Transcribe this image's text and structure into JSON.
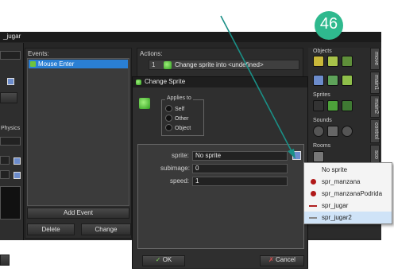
{
  "window": {
    "title": "_jugar"
  },
  "events": {
    "header": "Events:",
    "items": [
      "Mouse Enter"
    ],
    "add_button": "Add Event",
    "delete_button": "Delete",
    "change_button": "Change"
  },
  "actions": {
    "header": "Actions:",
    "items": [
      {
        "index": "1",
        "text": "Change sprite into <undefined>"
      }
    ]
  },
  "left_panel": {
    "fragment": "Physics"
  },
  "right_palette": {
    "objects_label": "Objects",
    "sprites_label": "Sprites",
    "sounds_label": "Sounds",
    "rooms_label": "Rooms",
    "tabs": [
      "move",
      "main1",
      "main2",
      "control",
      "sco"
    ]
  },
  "dialog": {
    "title": "Change Sprite",
    "applies_to": {
      "label": "Applies to",
      "options": [
        "Self",
        "Other",
        "Object"
      ]
    },
    "fields": {
      "sprite_label": "sprite:",
      "sprite_value": "No sprite",
      "subimage_label": "subimage:",
      "subimage_value": "0",
      "speed_label": "speed:",
      "speed_value": "1"
    },
    "ok_button": "OK",
    "cancel_button": "Cancel"
  },
  "sprite_menu": {
    "items": [
      "No sprite",
      "spr_manzana",
      "spr_manzanaPodrida",
      "spr_jugar",
      "spr_jugar2"
    ]
  },
  "badge": {
    "number": "46",
    "color": "#2fb98e"
  },
  "colors": {
    "event_selected": "#2a7fd4",
    "arrow": "#1a8f86"
  }
}
